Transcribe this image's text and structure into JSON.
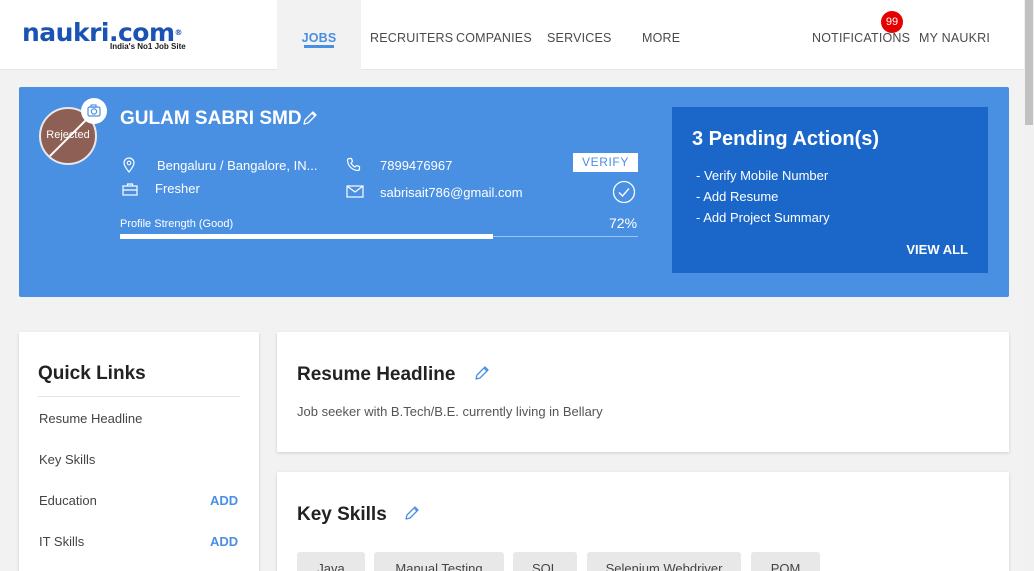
{
  "header": {
    "logo_text": "naukri.com",
    "logo_reg": "®",
    "logo_tagline": "India's No1 Job Site",
    "nav": [
      "JOBS",
      "RECRUITERS",
      "COMPANIES",
      "SERVICES",
      "MORE"
    ],
    "notifications_label": "NOTIFICATIONS",
    "notifications_count": "99",
    "my_naukri_label": "MY NAUKRI"
  },
  "profile": {
    "photo_status": "Rejected",
    "name": "GULAM SABRI SMD",
    "location": "Bengaluru / Bangalore, IN...",
    "experience": "Fresher",
    "phone": "7899476967",
    "email": "sabrisait786@gmail.com",
    "verify_label": "VERIFY",
    "strength_label": "Profile Strength (Good)",
    "strength_percent": "72%",
    "strength_value": 0.72
  },
  "pending": {
    "title": "3 Pending Action(s)",
    "items": [
      "Verify Mobile Number",
      "Add Resume",
      "Add Project Summary"
    ],
    "view_all": "VIEW ALL"
  },
  "quick_links": {
    "title": "Quick Links",
    "items": [
      {
        "label": "Resume Headline",
        "action": ""
      },
      {
        "label": "Key Skills",
        "action": ""
      },
      {
        "label": "Education",
        "action": "ADD"
      },
      {
        "label": "IT Skills",
        "action": "ADD"
      }
    ]
  },
  "resume_headline": {
    "title": "Resume Headline",
    "text": "Job seeker with B.Tech/B.E. currently living in Bellary"
  },
  "key_skills": {
    "title": "Key Skills",
    "chips": [
      "Java",
      "Manual Testing",
      "SQL",
      "Selenium Webdriver",
      "POM"
    ]
  },
  "colors": {
    "brand_blue": "#4a90e2",
    "dark_blue": "#1a67c9",
    "badge_red": "#e60000"
  }
}
